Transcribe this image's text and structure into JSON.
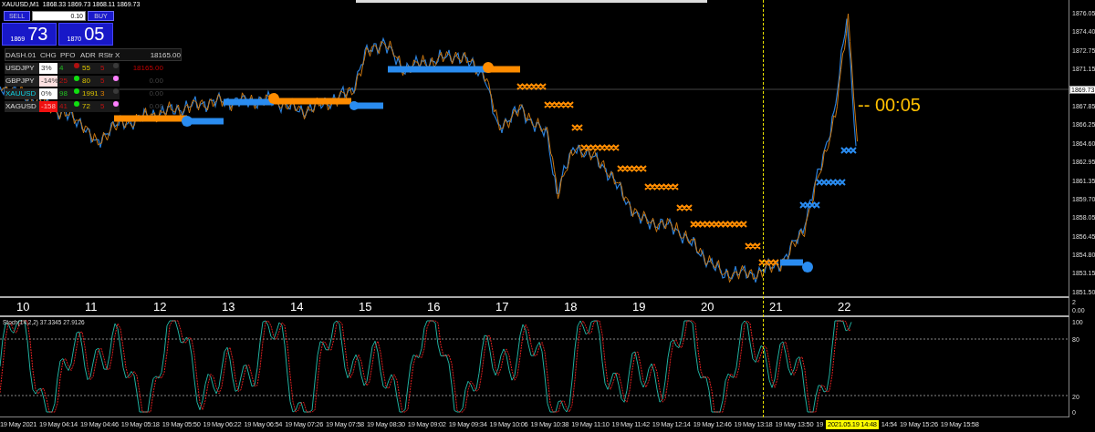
{
  "header": {
    "symbol": "XAUUSD,M1",
    "prices": "1868.33 1869.73 1868.11 1869.73"
  },
  "trade_panel": {
    "sell_label": "SELL",
    "buy_label": "BUY",
    "lot": "0.10",
    "sell_small": "1869",
    "sell_big": "73",
    "buy_small": "1870",
    "buy_big": "05"
  },
  "dashboard": {
    "title": "DASH.01",
    "columns": [
      "CHG",
      "PFO",
      "ADR",
      "RStr",
      "X"
    ],
    "balance": "18165.00",
    "rows": [
      {
        "symbol": "USDJPY",
        "selected": false,
        "chg": {
          "text": "3%",
          "kind": "plain"
        },
        "pfo": {
          "text": "4",
          "kind": "up"
        },
        "dot": {
          "color": "#b01010"
        },
        "adr": "55",
        "rstr": {
          "text": "5",
          "kind": "high"
        },
        "flag": {
          "color": "#3a3a3a"
        },
        "value": "18165.00",
        "value_active": true
      },
      {
        "symbol": "GBPJPY",
        "selected": false,
        "chg": {
          "text": "-14%",
          "kind": "light"
        },
        "pfo": {
          "text": "25",
          "kind": "down"
        },
        "dot": {
          "color": "#10e010"
        },
        "adr": "80",
        "rstr": {
          "text": "5",
          "kind": "high"
        },
        "flag": {
          "color": "#ff80ff"
        },
        "value": "0.00",
        "value_active": false
      },
      {
        "symbol": "XAUUSD",
        "selected": true,
        "chg": {
          "text": "0%",
          "kind": "plain"
        },
        "pfo": {
          "text": "98",
          "kind": "up"
        },
        "dot": {
          "color": "#10e010"
        },
        "adr": "1991",
        "rstr": {
          "text": "3",
          "kind": "mid"
        },
        "flag": {
          "color": "#3a3a3a"
        },
        "value": "0.00",
        "value_active": false
      },
      {
        "symbol": "XAGUSD",
        "selected": false,
        "chg": {
          "text": "-158",
          "kind": "strong"
        },
        "pfo": {
          "text": "41",
          "kind": "down"
        },
        "dot": {
          "color": "#10e010"
        },
        "adr": "72",
        "rstr": {
          "text": "5",
          "kind": "high"
        },
        "flag": {
          "color": "#ff80ff"
        },
        "value": "0.00",
        "value_active": false
      }
    ]
  },
  "countdown": "-- 00:05",
  "price_axis": {
    "ticks": [
      "1876.05",
      "1874.40",
      "1872.75",
      "1871.15",
      "1867.85",
      "1866.25",
      "1864.60",
      "1862.95",
      "1861.35",
      "1859.70",
      "1858.05",
      "1856.45",
      "1854.80",
      "1853.15",
      "1851.50"
    ],
    "current": "1869.73"
  },
  "hour_axis": {
    "labels": [
      "10",
      "11",
      "12",
      "13",
      "14",
      "15",
      "16",
      "17",
      "18",
      "19",
      "20",
      "21",
      "22"
    ],
    "scale": [
      "2",
      "0.00"
    ]
  },
  "stochastic": {
    "label": "Stoch(14,2,2) 37.3345 27.9126",
    "axis": [
      "100",
      "80",
      "20",
      "0"
    ]
  },
  "time_axis": {
    "labels": [
      {
        "text": "19 May 2021",
        "kind": "full"
      },
      {
        "text": "19 May 04:14",
        "kind": "full"
      },
      {
        "text": "19 May 04:46",
        "kind": "full"
      },
      {
        "text": "19 May 05:18",
        "kind": "full"
      },
      {
        "text": "19 May 05:50",
        "kind": "full"
      },
      {
        "text": "19 May 06:22",
        "kind": "full"
      },
      {
        "text": "19 May 06:54",
        "kind": "full"
      },
      {
        "text": "19 May 07:26",
        "kind": "full"
      },
      {
        "text": "19 May 07:58",
        "kind": "full"
      },
      {
        "text": "19 May 08:30",
        "kind": "full"
      },
      {
        "text": "19 May 09:02",
        "kind": "full"
      },
      {
        "text": "19 May 09:34",
        "kind": "full"
      },
      {
        "text": "19 May 10:06",
        "kind": "full"
      },
      {
        "text": "19 May 10:38",
        "kind": "full"
      },
      {
        "text": "19 May 11:10",
        "kind": "full"
      },
      {
        "text": "19 May 11:42",
        "kind": "full"
      },
      {
        "text": "19 May 12:14",
        "kind": "full"
      },
      {
        "text": "19 May 12:46",
        "kind": "full"
      },
      {
        "text": "19 May 13:18",
        "kind": "full"
      },
      {
        "text": "19 May 13:50",
        "kind": "full"
      },
      {
        "text": "19",
        "kind": "full"
      },
      {
        "text": "14:54",
        "kind": "partial"
      },
      {
        "text": "19 May 15:26",
        "kind": "full"
      },
      {
        "text": "19 May 15:58",
        "kind": "full"
      }
    ],
    "marker": "2021.05.19 14:48"
  }
}
